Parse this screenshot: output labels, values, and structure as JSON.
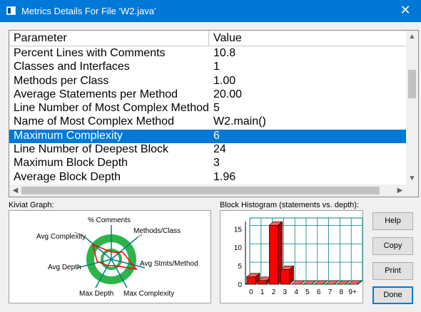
{
  "window": {
    "title": "Metrics Details For File 'W2.java'",
    "close_glyph": "✕"
  },
  "grid": {
    "headers": {
      "parameter": "Parameter",
      "value": "Value"
    },
    "rows": [
      {
        "parameter": "Percent Lines with Comments",
        "value": "10.8"
      },
      {
        "parameter": "Classes and Interfaces",
        "value": "1"
      },
      {
        "parameter": "Methods per Class",
        "value": "1.00"
      },
      {
        "parameter": "Average Statements per Method",
        "value": "20.00"
      },
      {
        "parameter": "Line Number of Most Complex Method",
        "value": "5"
      },
      {
        "parameter": "Name of Most Complex Method",
        "value": "W2.main()"
      },
      {
        "parameter": "Maximum Complexity",
        "value": "6",
        "selected": true
      },
      {
        "parameter": "Line Number of Deepest Block",
        "value": "24"
      },
      {
        "parameter": "Maximum Block Depth",
        "value": "3"
      },
      {
        "parameter": "Average Block Depth",
        "value": "1.96"
      }
    ]
  },
  "kiviat": {
    "label": "Kiviat Graph:",
    "axes": [
      "% Comments",
      "Methods/Class",
      "Avg Stmts/Method",
      "Max Complexity",
      "Max Depth",
      "Avg Depth",
      "Avg Complexity"
    ]
  },
  "histogram": {
    "label": "Block Histogram (statements vs. depth):",
    "y_ticks": [
      "15",
      "10",
      "5",
      "0"
    ],
    "x_labels": [
      "0",
      "1",
      "2",
      "3",
      "4",
      "5",
      "6",
      "7",
      "8",
      "9+"
    ],
    "bar_color": "#ff0000"
  },
  "chart_data": {
    "type": "bar",
    "title": "Block Histogram (statements vs. depth):",
    "categories": [
      "0",
      "1",
      "2",
      "3",
      "4",
      "5",
      "6",
      "7",
      "8",
      "9+"
    ],
    "values": [
      2,
      1,
      16,
      4,
      0,
      0,
      0,
      0,
      0,
      0
    ],
    "ylim": [
      0,
      17
    ],
    "grid": true
  },
  "buttons": {
    "help": "Help",
    "copy": "Copy",
    "print": "Print",
    "done": "Done"
  },
  "colors": {
    "selection": "#0078d7",
    "titlebar": "#0078d7",
    "kiviat_ring": "#2db34a",
    "kiviat_spokes": "#008080",
    "kiviat_polygon": "#ff0000"
  }
}
